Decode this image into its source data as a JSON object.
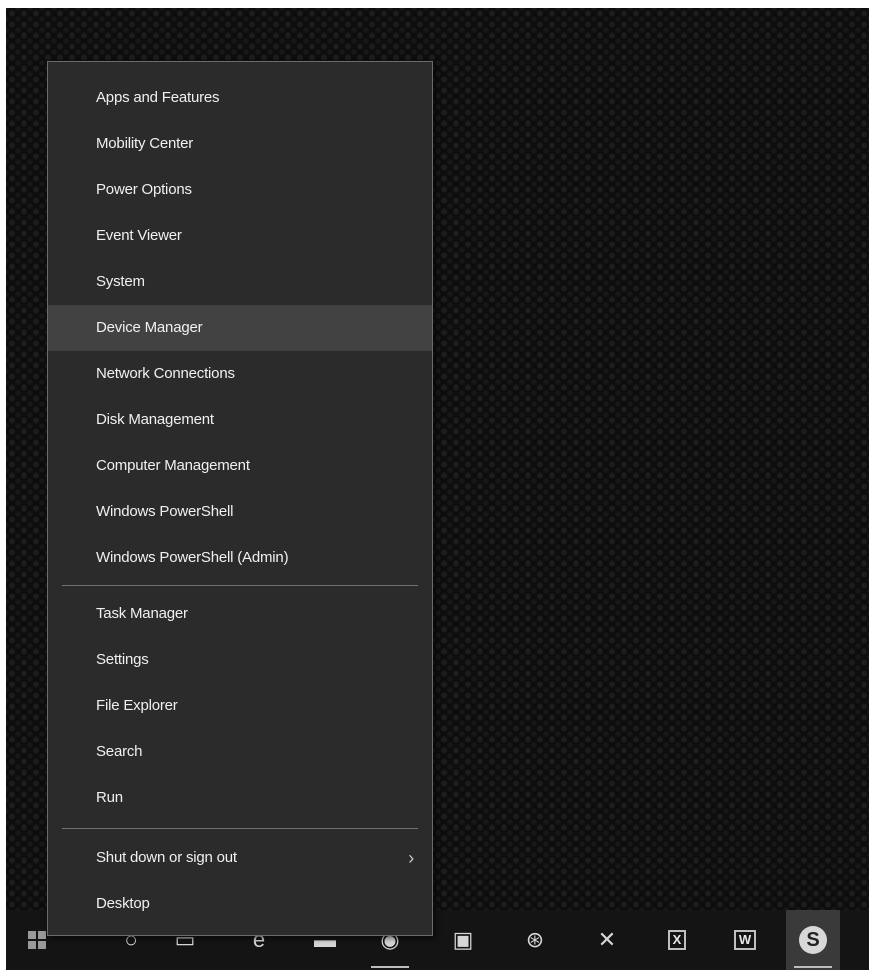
{
  "menu": {
    "group1": [
      {
        "label": "Apps and Features"
      },
      {
        "label": "Mobility Center"
      },
      {
        "label": "Power Options"
      },
      {
        "label": "Event Viewer"
      },
      {
        "label": "System"
      },
      {
        "label": "Device Manager",
        "highlighted": true
      },
      {
        "label": "Network Connections"
      },
      {
        "label": "Disk Management"
      },
      {
        "label": "Computer Management"
      },
      {
        "label": "Windows PowerShell"
      },
      {
        "label": "Windows PowerShell (Admin)"
      }
    ],
    "group2": [
      {
        "label": "Task Manager"
      },
      {
        "label": "Settings"
      },
      {
        "label": "File Explorer"
      },
      {
        "label": "Search"
      },
      {
        "label": "Run"
      }
    ],
    "group3": [
      {
        "label": "Shut down or sign out",
        "submenu_glyph": "›"
      },
      {
        "label": "Desktop"
      }
    ]
  },
  "taskbar": {
    "icons": [
      {
        "name": "start-icon"
      },
      {
        "name": "cortana-icon",
        "glyph": "○"
      },
      {
        "name": "task-view-icon",
        "glyph": "▭"
      },
      {
        "name": "edge-icon",
        "glyph": "e"
      },
      {
        "name": "file-explorer-icon",
        "glyph": "▬"
      },
      {
        "name": "chrome-icon",
        "glyph": "◉"
      },
      {
        "name": "control-panel-icon",
        "glyph": "▣"
      },
      {
        "name": "satellite-icon",
        "glyph": "⊛"
      },
      {
        "name": "tools-icon",
        "glyph": "✕"
      },
      {
        "name": "excel-icon",
        "glyph": "X"
      },
      {
        "name": "word-icon",
        "glyph": "W"
      },
      {
        "name": "skype-icon",
        "glyph": "S"
      }
    ]
  },
  "colors": {
    "menu_bg": "#2b2b2b",
    "menu_highlight": "#424242",
    "menu_text": "#f0f0f0",
    "taskbar_bg": "#141414"
  }
}
